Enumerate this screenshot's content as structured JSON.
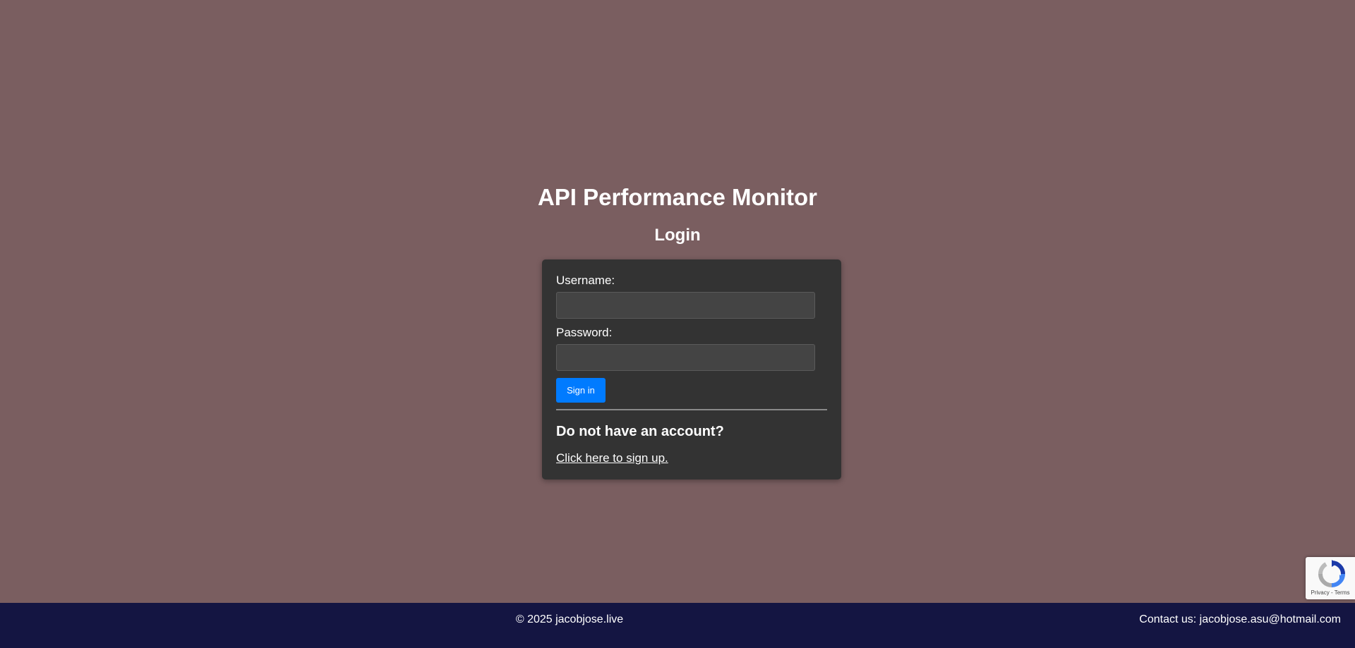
{
  "header": {
    "app_title": "API Performance Monitor",
    "page_heading": "Login"
  },
  "login_form": {
    "username_label": "Username:",
    "username_value": "",
    "password_label": "Password:",
    "password_value": "",
    "sign_in_label": "Sign in",
    "signup_question": "Do not have an account?",
    "signup_link": "Click here to sign up."
  },
  "recaptcha": {
    "icon": "recaptcha-icon",
    "terms_text": "Privacy - Terms"
  },
  "footer": {
    "copyright": "© 2025 jacobjose.live",
    "contact": "Contact us: jacobjose.asu@hotmail.com"
  },
  "colors": {
    "page_background": "#7a5e60",
    "card_background": "#333333",
    "input_background": "#444444",
    "primary_button": "#007bff",
    "footer_background": "#141542"
  }
}
